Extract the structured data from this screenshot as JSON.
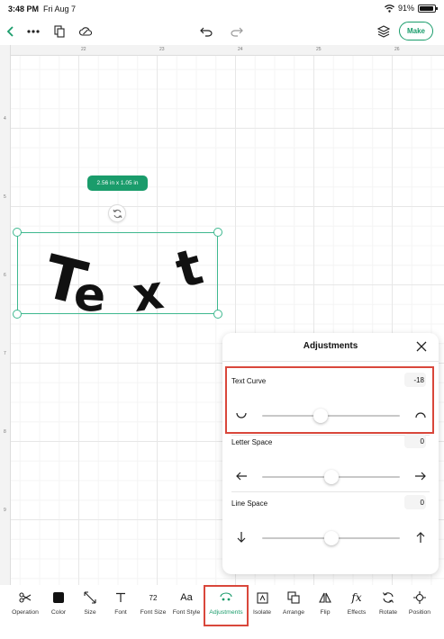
{
  "status": {
    "time": "3:48 PM",
    "date": "Fri Aug 7",
    "battery": "91%",
    "battery_level": 0.91
  },
  "toolbar": {
    "make_label": "Make"
  },
  "rulers": {
    "top": [
      "22",
      "23",
      "24",
      "25",
      "26"
    ],
    "left": [
      "4",
      "5",
      "6",
      "7",
      "8",
      "9"
    ]
  },
  "canvas": {
    "size_badge": "2.56 in x 1.05 in",
    "text": "Text"
  },
  "adjustments": {
    "title": "Adjustments",
    "text_curve": {
      "label": "Text Curve",
      "value": "-18"
    },
    "letter_space": {
      "label": "Letter Space",
      "value": "0"
    },
    "line_space": {
      "label": "Line Space",
      "value": "0"
    }
  },
  "bottom_bar": [
    {
      "label": "Operation",
      "icon": "scissors-icon"
    },
    {
      "label": "Color",
      "icon": "color-swatch-icon"
    },
    {
      "label": "Size",
      "icon": "resize-arrows-icon"
    },
    {
      "label": "Font",
      "icon": "font-t-icon"
    },
    {
      "label": "Font Size",
      "icon": "font-size-icon",
      "glyph": "72"
    },
    {
      "label": "Font Style",
      "icon": "font-style-icon",
      "glyph": "Aa"
    },
    {
      "label": "Adjustments",
      "icon": "adjustments-icon"
    },
    {
      "label": "Isolate",
      "icon": "isolate-icon"
    },
    {
      "label": "Arrange",
      "icon": "arrange-icon"
    },
    {
      "label": "Flip",
      "icon": "flip-icon"
    },
    {
      "label": "Effects",
      "icon": "effects-fx-icon"
    },
    {
      "label": "Rotate",
      "icon": "rotate-icon"
    },
    {
      "label": "Position",
      "icon": "position-icon"
    }
  ],
  "colors": {
    "accent": "#1a9c6b",
    "highlight": "#d9473b",
    "selection": "#3eb88f"
  }
}
